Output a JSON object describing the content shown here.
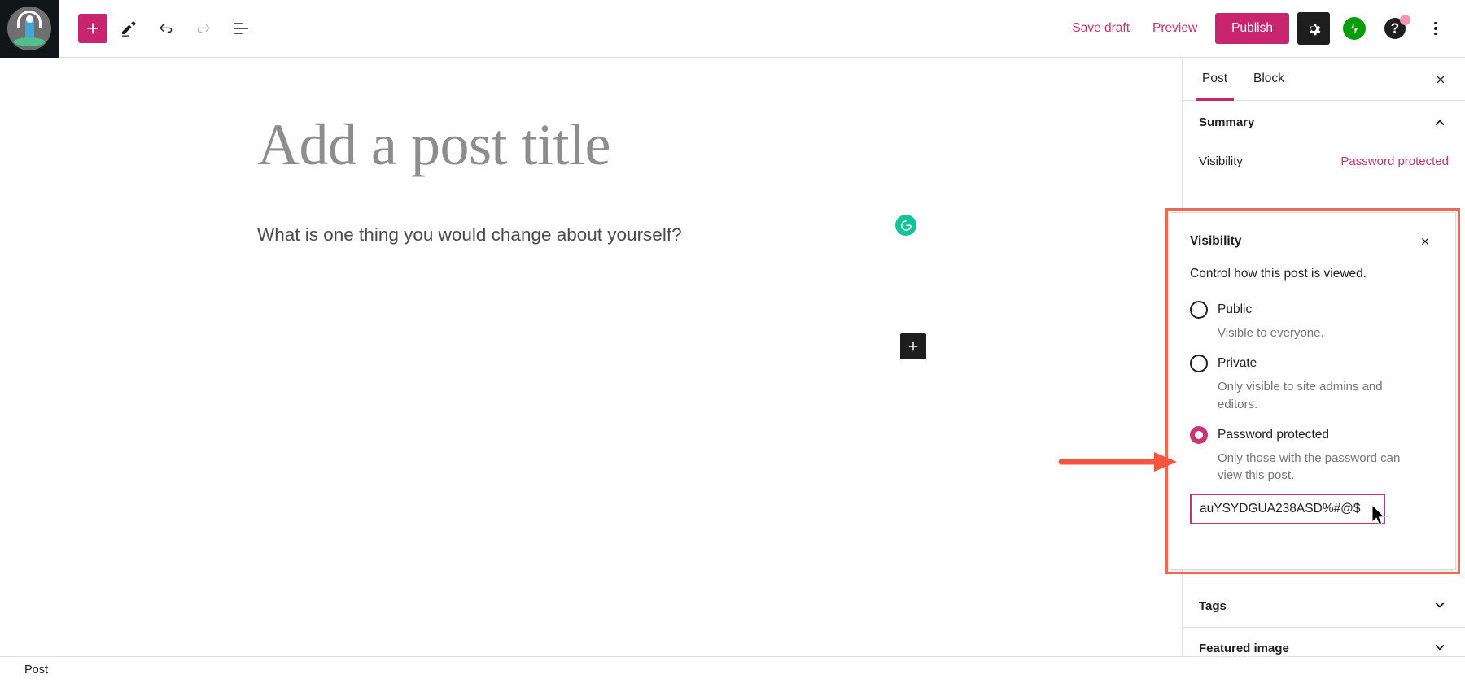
{
  "topbar": {
    "logo_name": "yoga-site-logo",
    "add_block_label": "+",
    "tools": [
      {
        "name": "add-block-button",
        "title": "Toggle block inserter"
      },
      {
        "name": "edit-tools-button",
        "title": "Tools"
      },
      {
        "name": "undo-button",
        "title": "Undo"
      },
      {
        "name": "redo-button",
        "title": "Redo"
      },
      {
        "name": "list-view-button",
        "title": "Document overview"
      }
    ],
    "save_draft_label": "Save draft",
    "preview_label": "Preview",
    "publish_label": "Publish",
    "settings_title": "Settings",
    "jetpack_title": "Jetpack",
    "help_title": "Help",
    "options_title": "Options"
  },
  "editor": {
    "title_placeholder": "Add a post title",
    "paragraph_text": "What is one thing you would change about yourself?",
    "grammarly_title": "Grammarly",
    "add_block_title": "Add block"
  },
  "sidebar": {
    "tabs": [
      {
        "label": "Post",
        "active": true
      },
      {
        "label": "Block",
        "active": false
      }
    ],
    "close_title": "Close settings",
    "summary": {
      "heading": "Summary",
      "visibility_label": "Visibility",
      "visibility_value": "Password protected"
    },
    "sections": [
      {
        "label": "Tags"
      },
      {
        "label": "Featured image"
      }
    ]
  },
  "visibility_popover": {
    "title": "Visibility",
    "close_title": "Close",
    "description": "Control how this post is viewed.",
    "options": [
      {
        "label": "Public",
        "help": "Visible to everyone.",
        "selected": false
      },
      {
        "label": "Private",
        "help": "Only visible to site admins and editors.",
        "selected": false
      },
      {
        "label": "Password protected",
        "help": "Only those with the password can view this post.",
        "selected": true
      }
    ],
    "password_value": "auYSYDGUA238ASD%#@$"
  },
  "bottombar": {
    "breadcrumb": "Post"
  },
  "colors": {
    "accent_pink": "#c9256e",
    "link_pink": "#c9356e",
    "annotation_red": "#ec6a55",
    "grammarly_green": "#15c39a",
    "jetpack_green": "#069e08",
    "badge_pink": "#f195b5",
    "dark": "#1e1e1e"
  }
}
